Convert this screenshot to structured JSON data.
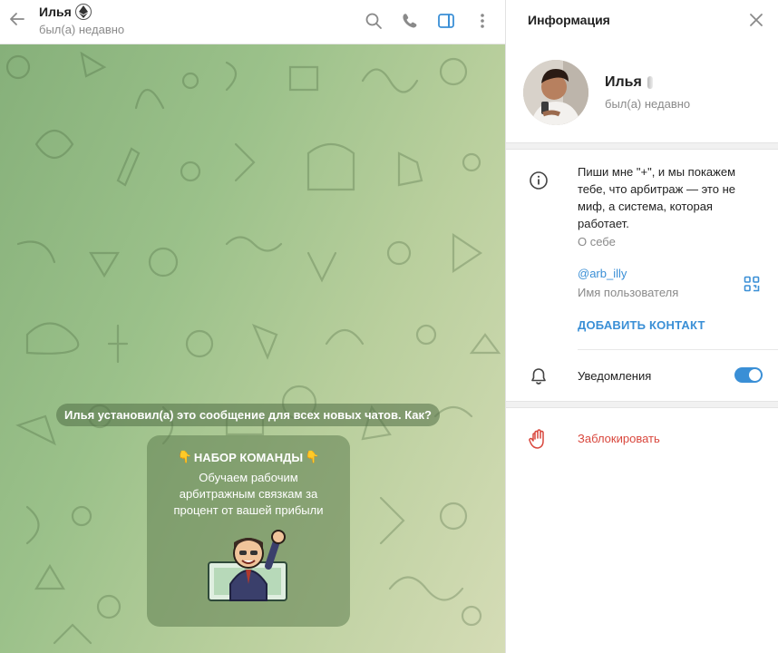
{
  "chat": {
    "title": "Илья",
    "status": "был(а) недавно",
    "service_message": "Илья установил(а) это сообщение для всех новых чатов. Как?",
    "card": {
      "title": "НАБОР КОМАНДЫ",
      "title_emoji": "👇",
      "text": "Обучаем рабочим арбитражным связкам за процент от вашей прибыли"
    }
  },
  "info": {
    "title": "Информация",
    "name": "Илья",
    "status": "был(а) недавно",
    "bio": "Пиши мне \"+\", и мы покажем тебе, что арбитраж — это не миф, а система, которая работает.",
    "bio_label": "О себе",
    "username": "@arb_illy",
    "username_label": "Имя пользователя",
    "add_contact": "ДОБАВИТЬ КОНТАКТ",
    "notifications_label": "Уведомления",
    "notifications_on": true,
    "block_label": "Заблокировать"
  },
  "colors": {
    "accent": "#3a8fd6",
    "danger": "#d9473d",
    "chat_bg_start": "#86b07a",
    "chat_bg_end": "#d5dcb6"
  },
  "icons": [
    "back-arrow-icon",
    "ethereum-icon",
    "search-icon",
    "phone-icon",
    "sidebar-toggle-icon",
    "more-vertical-icon",
    "close-icon",
    "info-icon",
    "qr-code-icon",
    "bell-icon",
    "hand-block-icon"
  ]
}
